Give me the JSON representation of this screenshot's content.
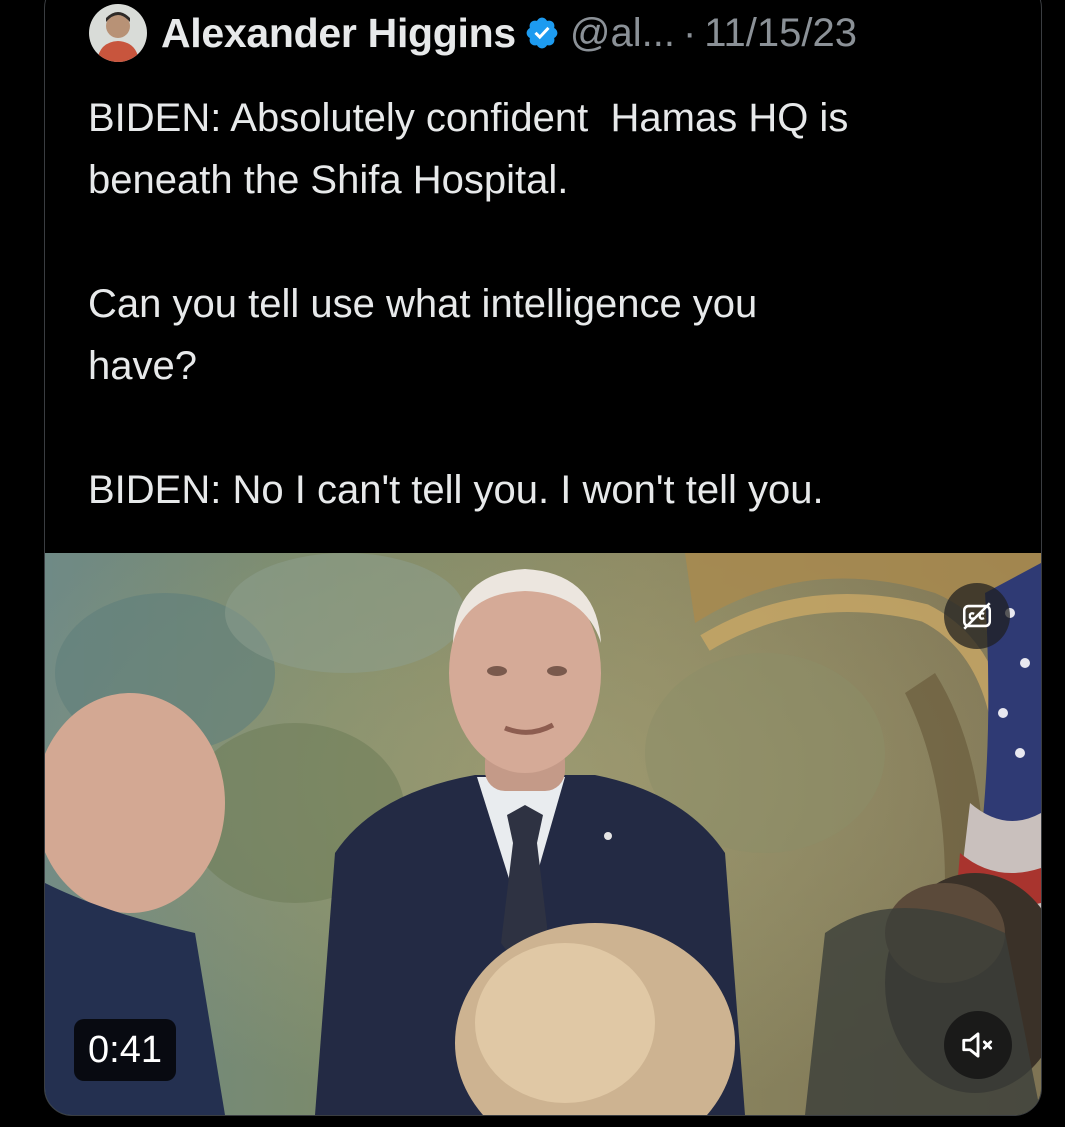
{
  "tweet": {
    "author": {
      "name": "Alexander Higgins",
      "handle": "@al...",
      "verified": true,
      "verified_color": "#1d9bf0"
    },
    "separator": "·",
    "date": "11/15/23",
    "text": "BIDEN: Absolutely confident  Hamas HQ is\nbeneath the Shifa Hospital.\n\nCan you tell use what intelligence you\nhave?\n\nBIDEN: No I can't tell you. I won't tell you."
  },
  "video": {
    "duration": "0:41",
    "captions_icon": "captions-off-icon",
    "volume_icon": "volume-muted-icon"
  },
  "colors": {
    "background": "#000000",
    "text": "#e7e9ea",
    "secondary_text": "#8b9197",
    "border": "#3a3d41"
  }
}
